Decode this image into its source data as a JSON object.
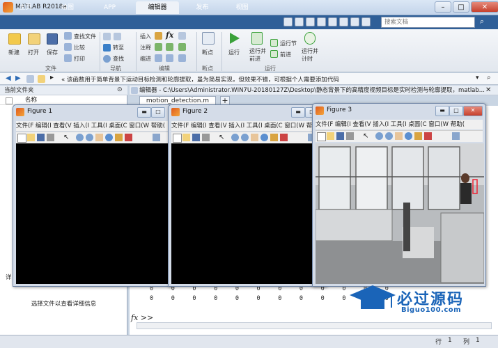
{
  "window": {
    "title": "MATLAB R2018a"
  },
  "tabs": [
    {
      "label": "主页"
    },
    {
      "label": "绘图"
    },
    {
      "label": "APP"
    },
    {
      "label": "编辑器"
    },
    {
      "label": "发布"
    },
    {
      "label": "视图"
    }
  ],
  "search": {
    "placeholder": "搜索文档"
  },
  "ribbon": {
    "file": {
      "new": "新建",
      "open": "打开",
      "save": "保存",
      "find_files": "查找文件",
      "compare": "比较",
      "print": "打印",
      "group": "文件"
    },
    "nav": {
      "goto": "转至",
      "find": "查找",
      "group": "导航"
    },
    "edit": {
      "insert": "插入",
      "comment": "注释",
      "indent": "缩进",
      "group": "编辑"
    },
    "breakpoints": {
      "label": "断点",
      "group": "断点"
    },
    "run": {
      "run": "运行",
      "run_advance": "运行并\n前进",
      "run_section": "运行节",
      "advance": "前进",
      "run_time": "运行并\n计时",
      "group": "运行"
    }
  },
  "address": {
    "text": "« 该函数用于简单背景下运动目标检测和轮廓提取，虽为简易实现，但效果不错，可根据个人需要添加代码"
  },
  "left_panel": {
    "header": "当前文件夹",
    "col_name": "名称",
    "detail_label": "详",
    "detail_text": "选择文件以查看详细信息"
  },
  "editor": {
    "title": "编辑器 - C:\\Users\\Administrator.WIN7U-20180127Z\\Desktop\\静态背景下的高精度视频目标是实时检测与轮廓提取，matlab...",
    "tab": "motion_detection.m",
    "add_tab": "+",
    "zero_row": "0     0     0     0     0     0     0     0     0     0     0     0",
    "prompt": "fx >>"
  },
  "figures": [
    {
      "title": "Figure 1",
      "menu": "文件(F  编辑(I  查看(V  插入(I  工具(I  桌面(C  窗口(W  帮助("
    },
    {
      "title": "Figure 2",
      "menu": "文件(F  编辑(I  查看(V  插入(I  工具(I  桌面(C  窗口(W  帮助("
    },
    {
      "title": "Figure 3",
      "menu": "文件(F  编辑(I  查看(V  插入(I  工具(I  桌面(C  窗口(W  帮助("
    }
  ],
  "status": {
    "row_label": "行",
    "row": "1",
    "col_label": "列",
    "col": "1"
  },
  "watermark": {
    "text": "必过源码",
    "url": "Biguo100.com"
  },
  "colors": {
    "tabbar": "#2f5f98",
    "accent": "#1a64b8",
    "run_green": "#3aa13a"
  }
}
